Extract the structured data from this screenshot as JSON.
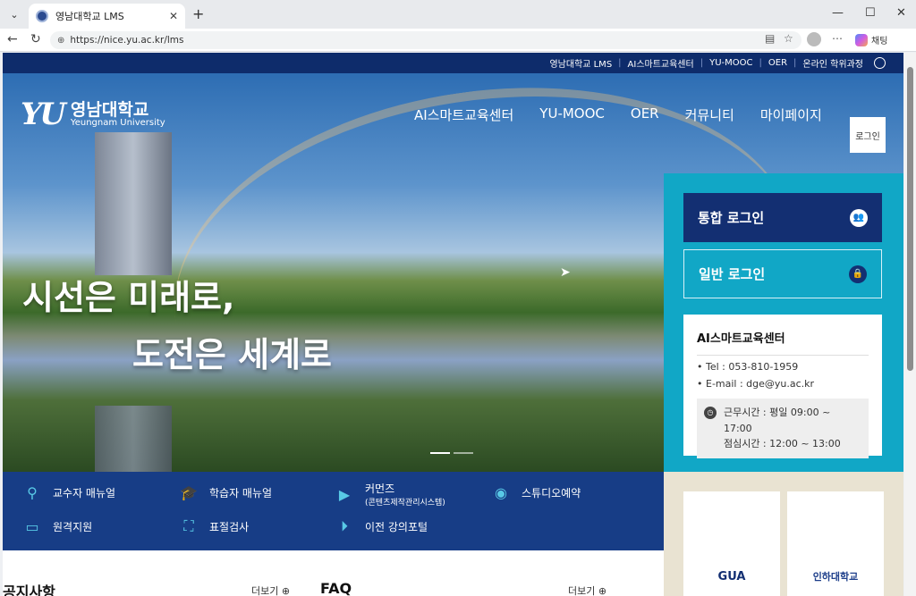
{
  "browser": {
    "tab_title": "영남대학교 LMS",
    "url": "https://nice.yu.ac.kr/lms",
    "chat_label": "채팅"
  },
  "util_links": [
    "영남대학교 LMS",
    "AI스마트교육센터",
    "YU-MOOC",
    "OER",
    "온라인 학위과정"
  ],
  "logo": {
    "mark": "YU",
    "name_kr": "영남대학교",
    "name_en": "Yeungnam University"
  },
  "gnb": [
    "AI스마트교육센터",
    "YU-MOOC",
    "OER",
    "커뮤니티",
    "마이페이지"
  ],
  "login_top": "로그인",
  "slogan": {
    "line1": "시선은 미래로,",
    "line2": "도전은 세계로"
  },
  "login": {
    "sso": "통합 로그인",
    "general": "일반 로그인"
  },
  "center": {
    "title": "AI스마트교육센터",
    "tel": "Tel : 053-810-1959",
    "email": "E-mail : dge@yu.ac.kr",
    "hours1": "근무시간 : 평일 09:00 ~ 17:00",
    "hours2": "점심시간 : 12:00 ~ 13:00"
  },
  "quicknav": {
    "prof_manual": "교수자 매뉴얼",
    "learner_manual": "학습자 매뉴얼",
    "contents": "커먼즈",
    "contents_sub": "(콘텐츠제작관리시스템)",
    "studio": "스튜디오예약",
    "remote": "원격지원",
    "plagiarism": "표절검사",
    "prev_portal": "이전 강의포털"
  },
  "partners": {
    "gua": "GUA",
    "inha": "인하대학교"
  },
  "boards": {
    "notice": "공지사항",
    "faq": "FAQ",
    "more": "더보기 ⊕"
  }
}
